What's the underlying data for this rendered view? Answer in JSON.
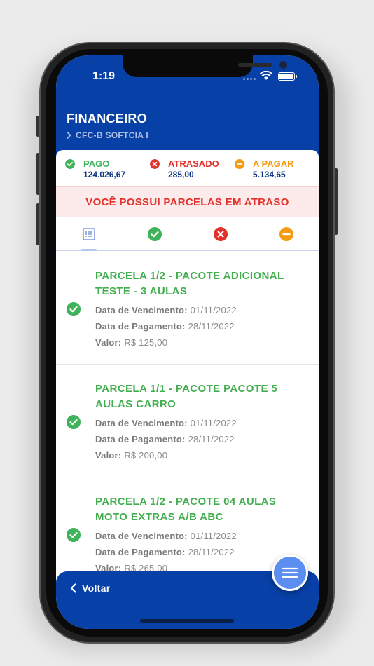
{
  "status_bar": {
    "time": "1:19"
  },
  "header": {
    "title": "FINANCEIRO",
    "breadcrumb": "CFC-B SOFTCIA I"
  },
  "summary": [
    {
      "label": "PAGO",
      "value": "124.026,67",
      "color": "#3fb35a",
      "icon": "check-circle-icon"
    },
    {
      "label": "ATRASADO",
      "value": "285,00",
      "color": "#e2312c",
      "icon": "x-circle-icon"
    },
    {
      "label": "A PAGAR",
      "value": "5.134,65",
      "color": "#f59b12",
      "icon": "minus-circle-icon"
    }
  ],
  "alert": {
    "text": "VOCÊ POSSUI PARCELAS EM ATRASO"
  },
  "tabs": [
    {
      "icon": "list-icon",
      "selected": true
    },
    {
      "icon": "check-circle-icon",
      "color": "#3fb35a"
    },
    {
      "icon": "x-circle-icon",
      "color": "#e2312c"
    },
    {
      "icon": "minus-circle-icon",
      "color": "#f59b12"
    }
  ],
  "installments": [
    {
      "title": "PARCELA 1/2 - PACOTE ADICIONAL TESTE - 3 AULAS",
      "due_label": "Data de Vencimento:",
      "due": "01/11/2022",
      "paid_label": "Data de Pagamento:",
      "paid": "28/11/2022",
      "value_label": "Valor:",
      "value": "R$ 125,00"
    },
    {
      "title": "PARCELA 1/1 - PACOTE PACOTE 5 AULAS CARRO",
      "due_label": "Data de Vencimento:",
      "due": "01/11/2022",
      "paid_label": "Data de Pagamento:",
      "paid": "28/11/2022",
      "value_label": "Valor:",
      "value": "R$ 200,00"
    },
    {
      "title": "PARCELA 1/2 - PACOTE 04 AULAS MOTO EXTRAS A/B ABC",
      "due_label": "Data de Vencimento:",
      "due": "01/11/2022",
      "paid_label": "Data de Pagamento:",
      "paid": "28/11/2022",
      "value_label": "Valor:",
      "value": "R$ 265,00"
    }
  ],
  "footer": {
    "back_label": "Voltar"
  },
  "colors": {
    "brand": "#0740a6",
    "paid": "#3fb35a",
    "late": "#e2312c",
    "pending": "#f59b12",
    "fab": "#5b8ef0"
  }
}
